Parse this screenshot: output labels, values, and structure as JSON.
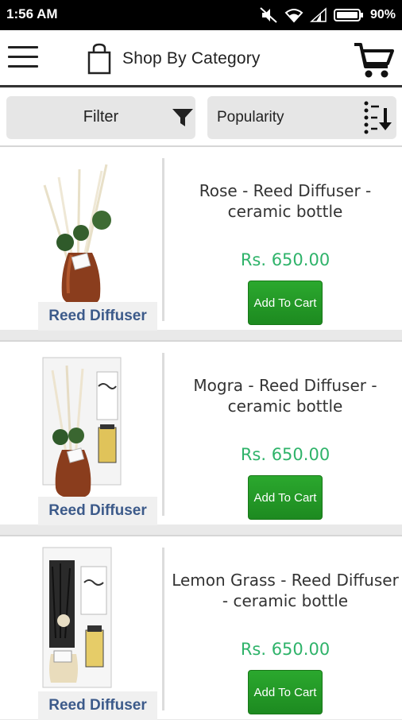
{
  "status_bar": {
    "time": "1:56 AM",
    "battery": "90%",
    "icons": [
      "mute-icon",
      "wifi-icon",
      "signal-icon",
      "battery-icon"
    ]
  },
  "app_bar": {
    "title": "Shop By Category",
    "icons": [
      "menu-icon",
      "shopping-bag-icon",
      "cart-icon"
    ]
  },
  "toolbar": {
    "filter_label": "Filter",
    "sort_label": "Popularity",
    "icons": [
      "filter-funnel-icon",
      "sort-down-icon"
    ]
  },
  "products": [
    {
      "name": "Rose - Reed Diffuser - ceramic bottle",
      "price": "Rs. 650.00",
      "category": "Reed Diffuser",
      "button": "Add To Cart"
    },
    {
      "name": "Mogra - Reed Diffuser - ceramic bottle",
      "price": "Rs. 650.00",
      "category": "Reed Diffuser",
      "button": "Add To Cart"
    },
    {
      "name": "Lemon Grass - Reed Diffuser - ceramic bottle",
      "price": "Rs. 650.00",
      "category": "Reed Diffuser",
      "button": "Add To Cart"
    }
  ],
  "colors": {
    "price": "#2fb36a",
    "button": "#1d8a20",
    "category_label": "#3c5a8a",
    "status_bar": "#000000"
  }
}
